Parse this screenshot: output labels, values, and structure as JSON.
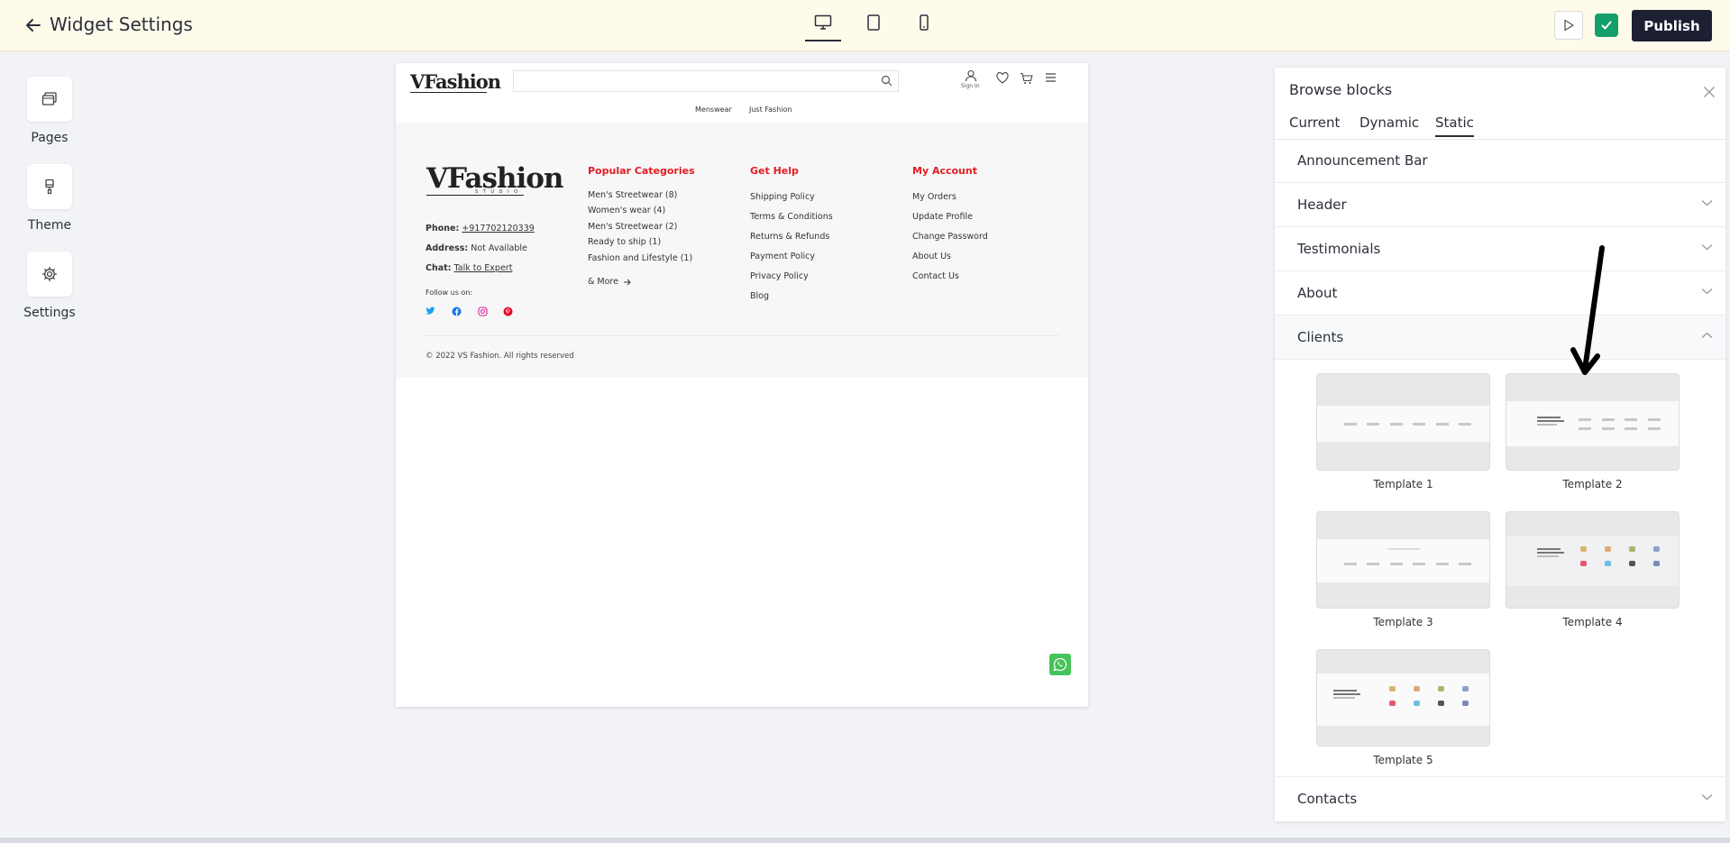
{
  "topbar": {
    "title": "Widget Settings",
    "publish_label": "Publish"
  },
  "rail": {
    "items": [
      {
        "label": "Pages",
        "icon": "pages-icon"
      },
      {
        "label": "Theme",
        "icon": "brush-icon"
      },
      {
        "label": "Settings",
        "icon": "gear-icon"
      }
    ]
  },
  "preview": {
    "logo": "VFashion",
    "logo_sub": "S T U D I O",
    "signin": "Sign In",
    "nav": [
      "Menswear",
      "Just Fashion"
    ],
    "contact": {
      "phone_label": "Phone:",
      "phone": "+917702120339",
      "address_label": "Address:",
      "address": "Not Available",
      "chat_label": "Chat:",
      "chat": "Talk to Expert",
      "follow": "Follow us on:"
    },
    "popular": {
      "title": "Popular Categories",
      "items": [
        "Men's Streetwear (8)",
        "Women's wear (4)",
        "Men's Streetwear (2)",
        "Ready to ship (1)",
        "Fashion and Lifestyle (1)"
      ],
      "more": "& More"
    },
    "help": {
      "title": "Get Help",
      "items": [
        "Shipping Policy",
        "Terms & Conditions",
        "Returns & Refunds",
        "Payment Policy",
        "Privacy Policy",
        "Blog"
      ]
    },
    "account": {
      "title": "My Account",
      "items": [
        "My Orders",
        "Update Profile",
        "Change Password",
        "About Us",
        "Contact Us"
      ]
    },
    "copyright": "© 2022 VS Fashion. All rights reserved"
  },
  "panel": {
    "title": "Browse blocks",
    "tabs": [
      "Current",
      "Dynamic",
      "Static"
    ],
    "active_tab": "Static",
    "sections": [
      "Announcement Bar",
      "Header",
      "Testimonials",
      "About",
      "Clients",
      "Contacts"
    ],
    "open_section": "Clients",
    "templates": [
      "Template 1",
      "Template 2",
      "Template 3",
      "Template 4",
      "Template 5"
    ]
  },
  "colors": {
    "topbar_bg": "#fffbeb",
    "publish_bg": "#1d1f33",
    "check_green": "#15a06b",
    "footer_heading": "#e21c23",
    "whatsapp": "#46c35b"
  }
}
